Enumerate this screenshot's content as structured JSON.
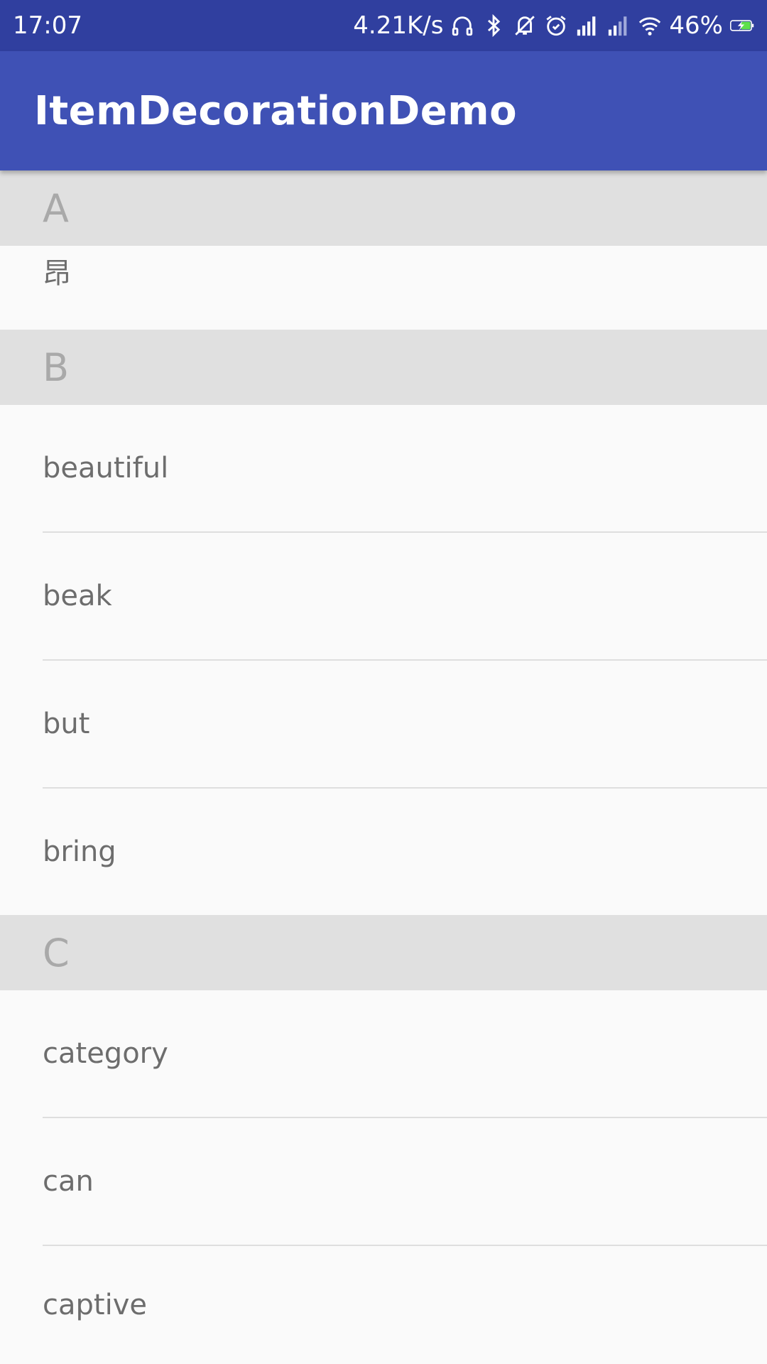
{
  "status_bar": {
    "time": "17:07",
    "network_speed": "4.21K/s",
    "battery_percent": "46%",
    "icons": [
      "headphones-icon",
      "bluetooth-icon",
      "vibrate-off-icon",
      "alarm-icon",
      "signal-icon",
      "signal-icon-2",
      "wifi-icon",
      "battery-charging-icon"
    ]
  },
  "app_bar": {
    "title": "ItemDecorationDemo",
    "color": "#3f51b5"
  },
  "sections": [
    {
      "letter": "A",
      "items": [
        "昂"
      ]
    },
    {
      "letter": "B",
      "items": [
        "beautiful",
        "beak",
        "but",
        "bring"
      ]
    },
    {
      "letter": "C",
      "items": [
        "category",
        "can",
        "captive"
      ]
    }
  ],
  "colors": {
    "status_bar": "#303f9f",
    "header_bg": "#e0e0e0",
    "header_text": "#a9a9a9",
    "item_text": "#6d6d6d",
    "divider": "#dedede"
  }
}
